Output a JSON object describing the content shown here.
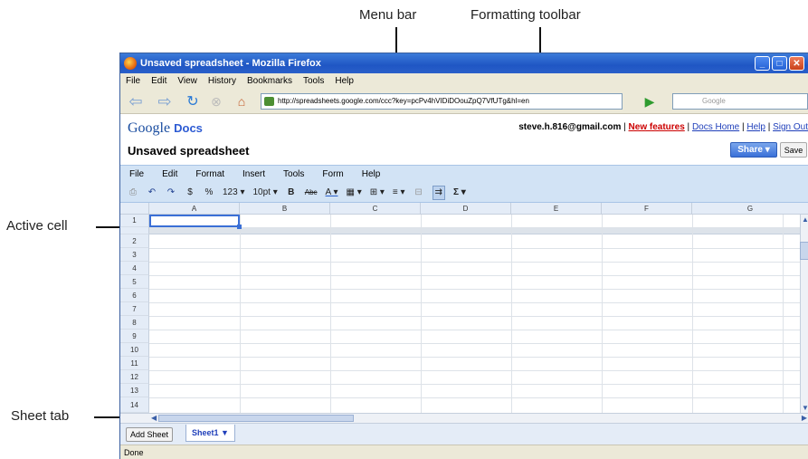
{
  "callouts": {
    "menu_bar": "Menu bar",
    "formatting_toolbar": "Formatting toolbar",
    "active_cell": "Active cell",
    "sheet_tab": "Sheet tab"
  },
  "browser": {
    "title": "Unsaved spreadsheet - Mozilla Firefox",
    "menu": [
      "File",
      "Edit",
      "View",
      "History",
      "Bookmarks",
      "Tools",
      "Help"
    ],
    "url": "http://spreadsheets.google.com/ccc?key=pcPv4hVIDiDOouZpQ7VfUTg&hl=en",
    "search_placeholder": "Google",
    "status": "Done"
  },
  "docs": {
    "logo_google": "Google",
    "logo_docs": "Docs",
    "doc_title": "Unsaved spreadsheet",
    "user_email": "steve.h.816@gmail.com",
    "links": {
      "new_features": "New features",
      "docs_home": "Docs Home",
      "help": "Help",
      "sign_out": "Sign Out"
    },
    "share_label": "Share ▾",
    "save_label": "Save"
  },
  "app_menu": [
    "File",
    "Edit",
    "Format",
    "Insert",
    "Tools",
    "Form",
    "Help"
  ],
  "toolbar": {
    "dollar": "$",
    "percent": "%",
    "number_format": "123 ▾",
    "font_size": "10pt ▾",
    "bold": "B",
    "strike": "Abc",
    "text_color": "A ▾",
    "sum": "Σ ▾"
  },
  "grid": {
    "columns": [
      "A",
      "B",
      "C",
      "D",
      "E",
      "F",
      "G"
    ],
    "frozen_row": "1",
    "rows": [
      "2",
      "3",
      "4",
      "5",
      "6",
      "7",
      "8",
      "9",
      "10",
      "11",
      "12",
      "13",
      "14"
    ]
  },
  "sheets": {
    "add_label": "Add Sheet",
    "tab_label": "Sheet1 ▼"
  }
}
